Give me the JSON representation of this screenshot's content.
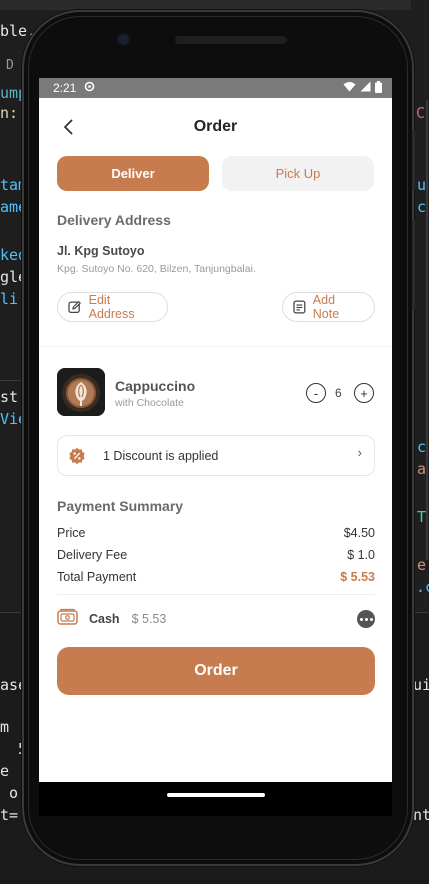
{
  "status_bar": {
    "time": "2:21"
  },
  "header": {
    "title": "Order"
  },
  "tabs": {
    "deliver": "Deliver",
    "pickup": "Pick Up"
  },
  "address": {
    "section_title": "Delivery Address",
    "name": "Jl. Kpg Sutoyo",
    "detail": "Kpg. Sutoyo No. 620, Bilzen, Tanjungbalai.",
    "edit_label": "Edit Address",
    "note_label": "Add Note"
  },
  "product": {
    "name": "Cappuccino",
    "subtitle": "with Chocolate",
    "quantity": "6",
    "minus": "-",
    "plus": "+"
  },
  "discount": {
    "label": "1 Discount is applied",
    "chevron": "›"
  },
  "payment": {
    "section_title": "Payment Summary",
    "rows": [
      {
        "label": "Price",
        "value": "$4.50"
      },
      {
        "label": "Delivery Fee",
        "value": "$ 1.0"
      },
      {
        "label": "Total Payment",
        "value": "$ 5.53"
      }
    ],
    "method": "Cash",
    "method_amount": "$ 5.53"
  },
  "order_button": "Order",
  "ide_snippets": {
    "tab_frag": "ble.t",
    "tab_d": "D",
    "l1": "ump",
    "l2": "n:",
    "l3": "tam",
    "l4": "ame",
    "l5": "ked",
    "l6": "gle",
    "l7": "li",
    "l8": "st",
    "l9": "Vie",
    "l10": "ase",
    "l11": "m ",
    "l12": "  5",
    "l13": "e ",
    "l14": " o",
    "l15": "t=",
    "r1": "C",
    "r2": "u",
    "r3": "c",
    "r4": "c",
    "r5": "a",
    "r6": "T",
    "r7": "e",
    "r8": ".c",
    "r9": "ui",
    "r10": "nt"
  },
  "colors": {
    "accent": "#c67c4e",
    "ide_bg": "#1e1e1e"
  }
}
